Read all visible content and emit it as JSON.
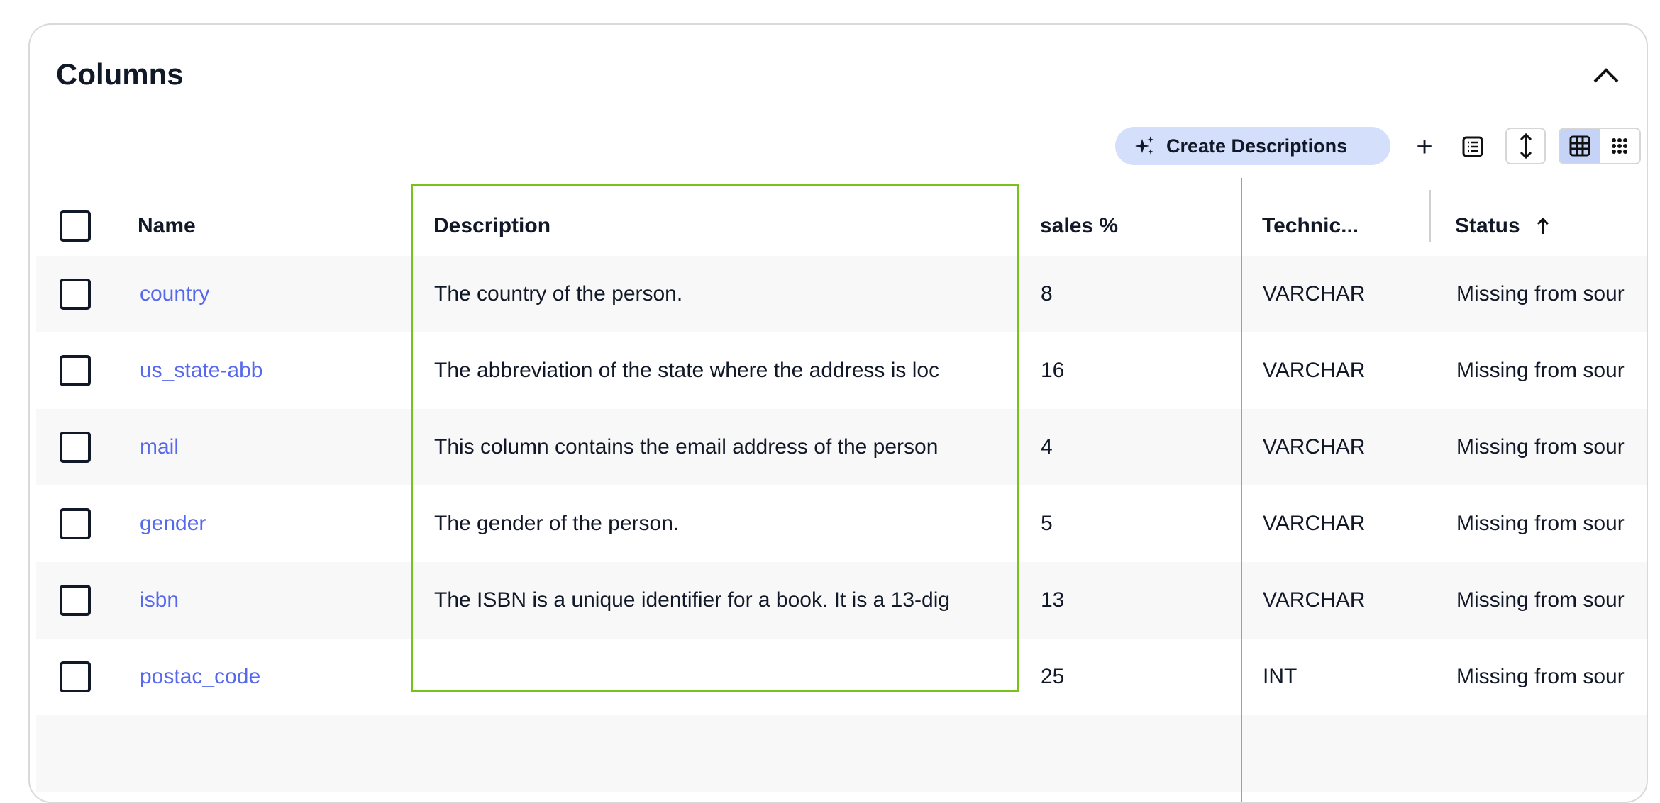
{
  "section": {
    "title": "Columns"
  },
  "toolbar": {
    "create_descriptions_label": "Create Descriptions",
    "add_icon": "plus-icon",
    "list_icon": "list-icon",
    "row_height_icon": "vertical-arrows-icon",
    "view_grid_icon": "grid-icon",
    "view_compact_icon": "dots-grid-icon",
    "active_view": "grid"
  },
  "table": {
    "headers": {
      "name": "Name",
      "description": "Description",
      "sales": "sales %",
      "technical": "Technic...",
      "status": "Status",
      "status_sort": "ascending"
    },
    "rows": [
      {
        "name": "country",
        "description": "The country of the person.",
        "sales": "8",
        "technical": "VARCHAR",
        "status": "Missing from sour"
      },
      {
        "name": "us_state-abb",
        "description": "The abbreviation of the state where the address is loc",
        "sales": "16",
        "technical": "VARCHAR",
        "status": "Missing from sour"
      },
      {
        "name": "mail",
        "description": "This column contains the email address of the person",
        "sales": "4",
        "technical": "VARCHAR",
        "status": "Missing from sour"
      },
      {
        "name": "gender",
        "description": "The gender of the person.",
        "sales": "5",
        "technical": "VARCHAR",
        "status": "Missing from sour"
      },
      {
        "name": "isbn",
        "description": "The ISBN is a unique identifier for a book. It is a 13-dig",
        "sales": "13",
        "technical": "VARCHAR",
        "status": "Missing from sour"
      },
      {
        "name": "postac_code",
        "description": "",
        "sales": "25",
        "technical": "INT",
        "status": "Missing from sour"
      }
    ]
  },
  "colors": {
    "link": "#5668ec",
    "highlight_border": "#78c21a",
    "create_button_bg": "#d4dffb"
  }
}
